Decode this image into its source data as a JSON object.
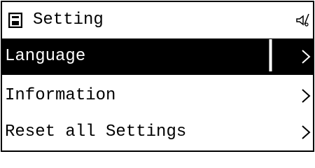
{
  "header": {
    "icon": "floppy-disk-icon",
    "title": "Setting",
    "status_icon": "sound-off-icon"
  },
  "menu": {
    "items": [
      {
        "label": "Language",
        "selected": true,
        "icon": "chevron-right-icon"
      },
      {
        "label": "Information",
        "selected": false,
        "icon": "chevron-right-icon"
      },
      {
        "label": "Reset all Settings",
        "selected": false,
        "icon": "chevron-right-icon"
      }
    ]
  },
  "colors": {
    "background": "#ffffff",
    "foreground": "#000000",
    "selection": "#000000",
    "selection_text": "#ffffff"
  }
}
